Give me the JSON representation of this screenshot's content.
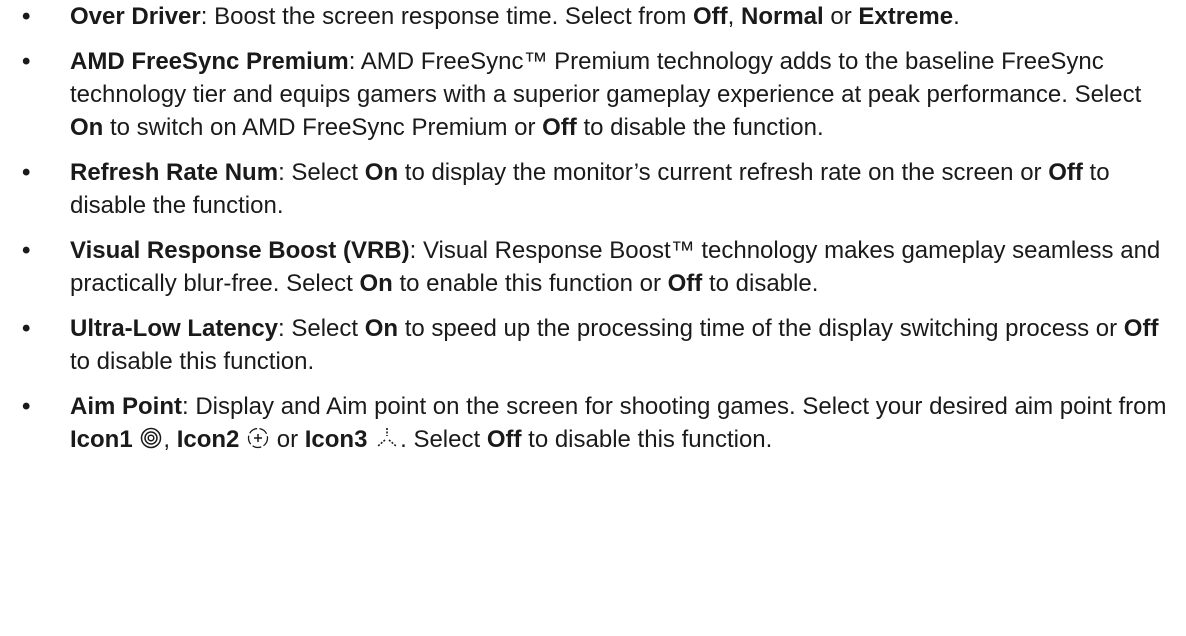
{
  "bullet_glyph": "•",
  "items": [
    {
      "term": "Over Driver",
      "t1": ": Boost the screen response time. Select from ",
      "k1": "Off",
      "t2": ", ",
      "k2": "Normal",
      "t3": " or ",
      "k3": "Extreme",
      "t4": "."
    },
    {
      "term": "AMD FreeSync Premium",
      "t1": ": AMD FreeSync™ Premium technology adds to the baseline FreeSync technology tier and equips gamers with a superior gameplay experience at peak performance. Select ",
      "k1": "On",
      "t2": " to switch on AMD FreeSync Premium or ",
      "k2": "Off",
      "t3": " to disable the function."
    },
    {
      "term": "Refresh Rate Num",
      "t1": ": Select ",
      "k1": "On",
      "t2": " to display the monitor’s current refresh rate on the screen or ",
      "k2": "Off",
      "t3": " to disable the function."
    },
    {
      "term": "Visual Response Boost (VRB)",
      "t1": ": Visual Response Boost™ technology makes gameplay seamless and practically blur-free. Select ",
      "k1": "On",
      "t2": " to enable this function or ",
      "k2": "Off",
      "t3": " to disable."
    },
    {
      "term": "Ultra-Low Latency",
      "t1": ": Select ",
      "k1": "On",
      "t2": " to speed up the processing time of the display switching process or ",
      "k2": "Off",
      "t3": " to disable this function."
    },
    {
      "term": "Aim Point",
      "t1": ": Display and Aim point on the screen for shooting games. Select your desired aim point from ",
      "k1": "Icon1",
      "icon1": "target-rings-icon",
      "t2": ", ",
      "k2": "Icon2",
      "icon2": "circle-crosshair-icon",
      "t3": " or ",
      "k3": "Icon3",
      "icon3": "tri-dash-crosshair-icon",
      "t4": ". Select ",
      "k4": "Off",
      "t5": " to disable this function."
    }
  ]
}
